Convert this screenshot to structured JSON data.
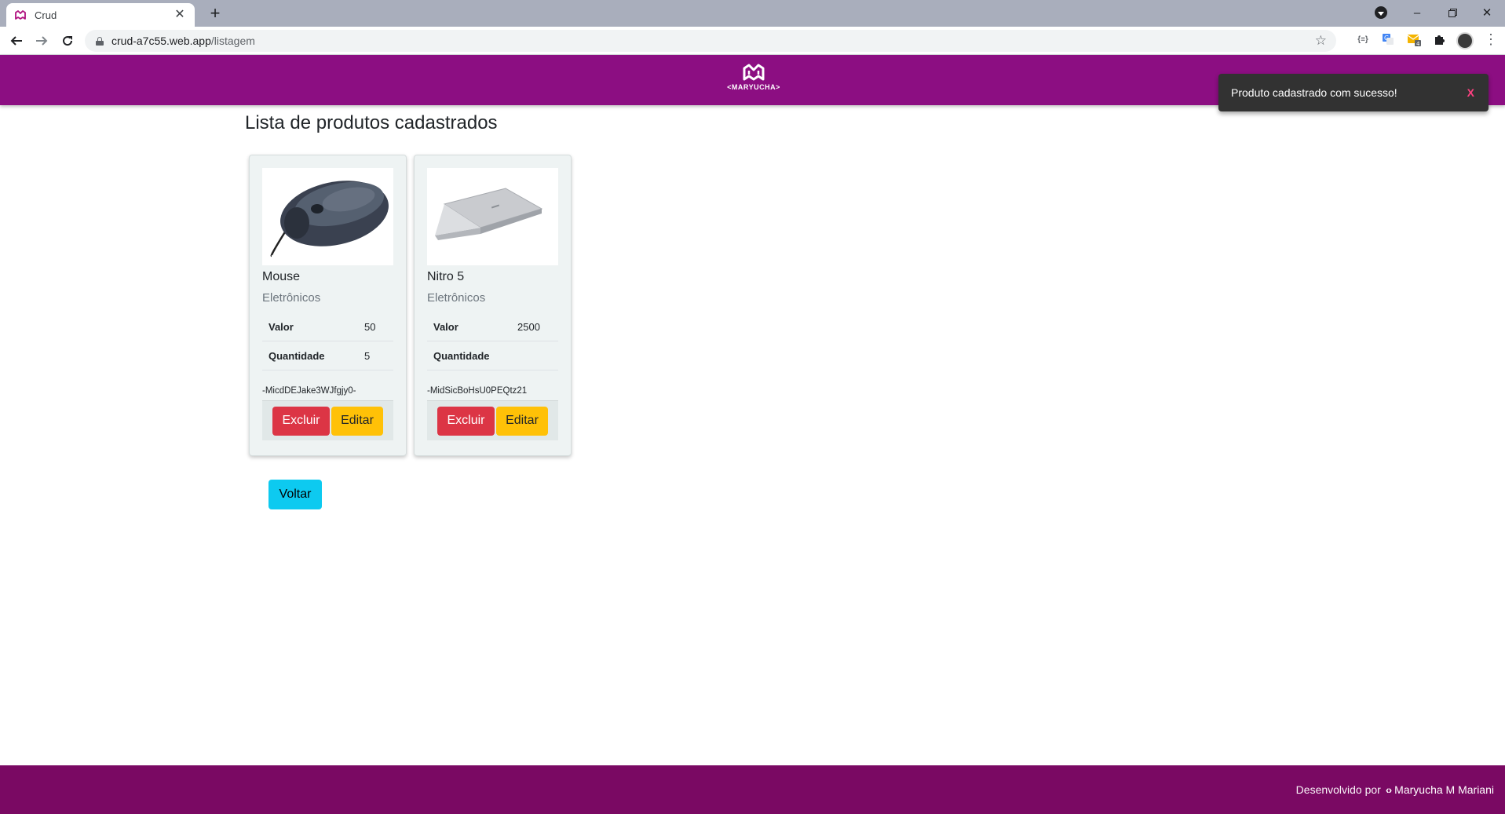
{
  "browser": {
    "tab_title": "Crud",
    "url_host": "crud-a7c55.web.app",
    "url_path": "/listagem"
  },
  "header": {
    "logo_text": "<MARYUCHA>"
  },
  "toast": {
    "message": "Produto cadastrado com sucesso!",
    "close_label": "X"
  },
  "main": {
    "title": "Lista de produtos cadastrados",
    "back_label": "Voltar"
  },
  "products": [
    {
      "name": "Mouse",
      "category": "Eletrônicos",
      "value_label": "Valor",
      "value": "50",
      "qty_label": "Quantidade",
      "qty": "5",
      "id": "-MicdDEJake3WJfgjy0-",
      "delete_label": "Excluir",
      "edit_label": "Editar"
    },
    {
      "name": "Nitro 5",
      "category": "Eletrônicos",
      "value_label": "Valor",
      "value": "2500",
      "qty_label": "Quantidade",
      "qty": "",
      "id": "-MidSicBoHsU0PEQtz21",
      "delete_label": "Excluir",
      "edit_label": "Editar"
    }
  ],
  "footer": {
    "prefix": "Desenvolvido por",
    "author": "Maryucha M Mariani"
  },
  "colors": {
    "header": "#8c0e82",
    "footer": "#7a0963",
    "danger": "#dc3545",
    "warning": "#ffc107",
    "info": "#0dcaf0"
  },
  "icons": [
    "maryucha-favicon",
    "close-icon",
    "plus-icon",
    "back-arrow-icon",
    "forward-arrow-icon",
    "reload-icon",
    "lock-icon",
    "star-icon",
    "extensions-icon",
    "kebab-menu-icon",
    "code-brackets-icon"
  ]
}
